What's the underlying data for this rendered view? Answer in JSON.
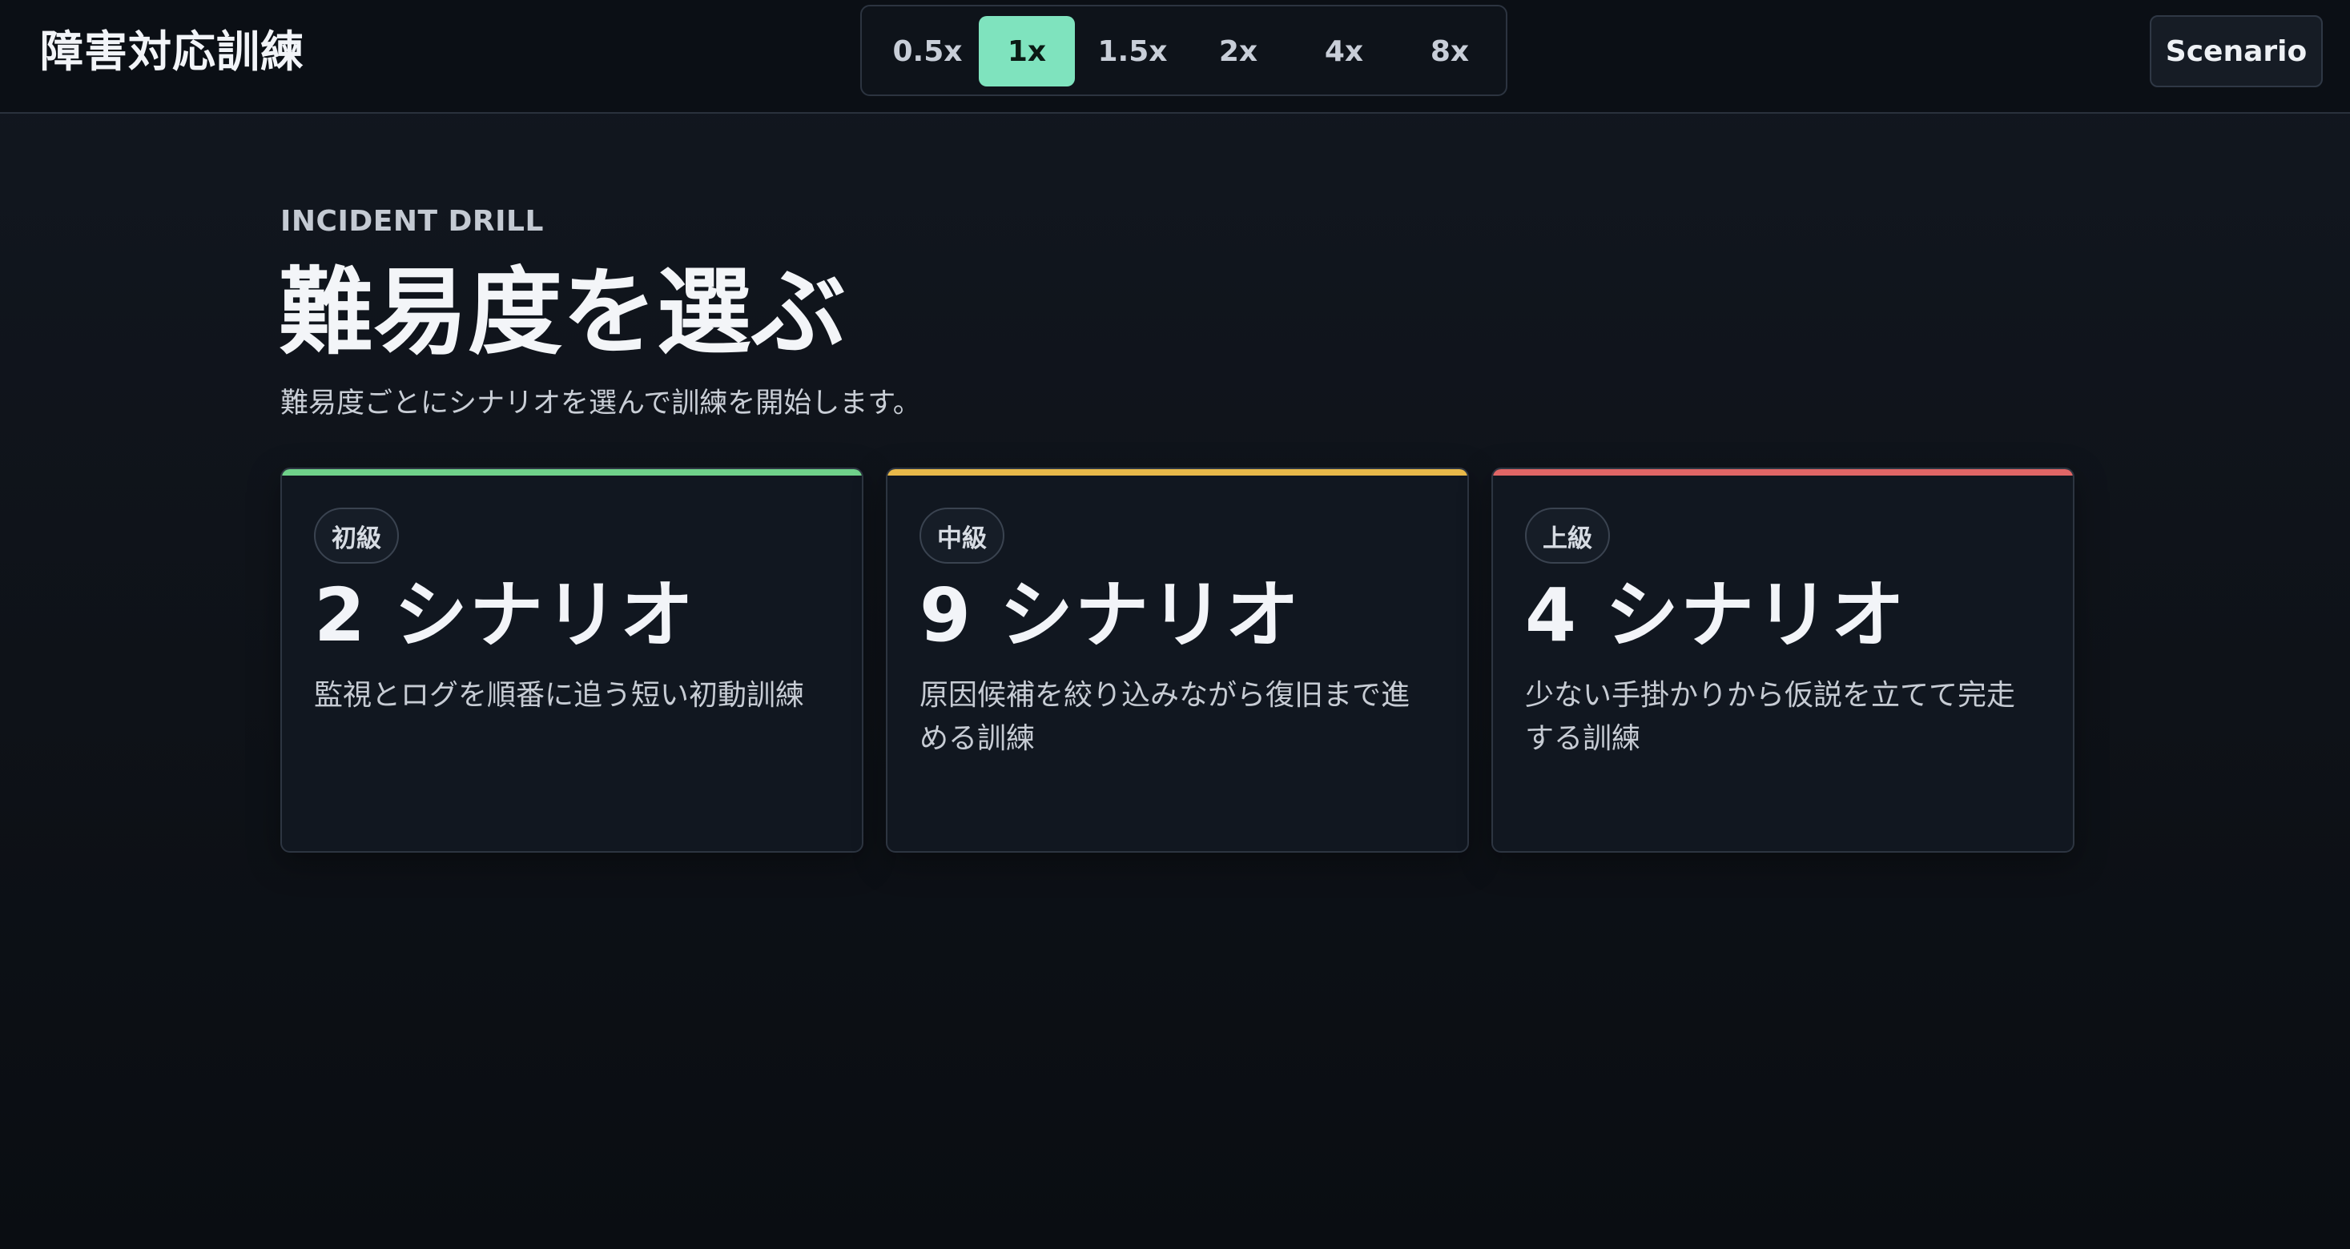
{
  "header": {
    "app_title": "障害対応訓練",
    "scenario_label": "Scenario"
  },
  "speed": {
    "options": [
      "0.5x",
      "1x",
      "1.5x",
      "2x",
      "4x",
      "8x"
    ],
    "selected": "1x"
  },
  "main": {
    "eyebrow": "INCIDENT DRILL",
    "title": "難易度を選ぶ",
    "subtitle": "難易度ごとにシナリオを選んで訓練を開始します。"
  },
  "cards": [
    {
      "level": "初級",
      "count": "2 シナリオ",
      "description": "監視とログを順番に追う短い初動訓練",
      "accent": "#6fd18a"
    },
    {
      "level": "中級",
      "count": "9 シナリオ",
      "description": "原因候補を絞り込みながら復旧まで進める訓練",
      "accent": "#e8b94a"
    },
    {
      "level": "上級",
      "count": "4 シナリオ",
      "description": "少ない手掛かりから仮説を立てて完走する訓練",
      "accent": "#e06666"
    }
  ]
}
